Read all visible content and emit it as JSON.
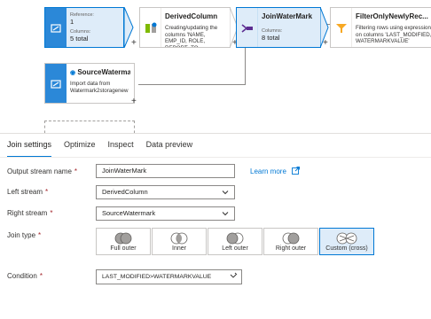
{
  "canvas": {
    "reference_node": {
      "label": "Reference:",
      "value": "1",
      "columns_label": "Columns:",
      "columns_value": "5 total"
    },
    "derived_column_node": {
      "title": "DerivedColumn",
      "description": "Creating/updating the columns 'NAME, EMP_ID, ROLE, REPORT_TO, LAST_MODIFIED'"
    },
    "join_watermark_node": {
      "title": "JoinWaterMark",
      "columns_label": "Columns:",
      "columns_value": "8 total"
    },
    "filter_node": {
      "title": "FilterOnlyNewlyRec...",
      "description": "Filtering rows using expressions on columns 'LAST_MODIFIED, WATERMARKVALUE'"
    },
    "source_watermark_node": {
      "title": "SourceWatermark",
      "description": "Import data from Watermark2storagenew"
    },
    "plus_symbol": "+"
  },
  "tabs": [
    {
      "label": "Join settings",
      "active": true
    },
    {
      "label": "Optimize",
      "active": false
    },
    {
      "label": "Inspect",
      "active": false
    },
    {
      "label": "Data preview",
      "active": false
    }
  ],
  "form": {
    "required_mark": "*",
    "output_stream": {
      "label": "Output stream name",
      "value": "JoinWaterMark"
    },
    "learn_more": "Learn more",
    "left_stream": {
      "label": "Left stream",
      "value": "DerivedColumn"
    },
    "right_stream": {
      "label": "Right stream",
      "value": "SourceWatermark"
    },
    "join_type": {
      "label": "Join type",
      "options": [
        {
          "label": "Full outer",
          "selected": false
        },
        {
          "label": "Inner",
          "selected": false
        },
        {
          "label": "Left outer",
          "selected": false
        },
        {
          "label": "Right outer",
          "selected": false
        },
        {
          "label": "Custom (cross)",
          "selected": true
        }
      ]
    },
    "condition": {
      "label": "Condition",
      "value": "LAST_MODIFIED>WATERMARKVALUE"
    }
  },
  "colors": {
    "accent": "#0078d4",
    "selected_bg": "#deecf9",
    "node_icon": "#2b88d8",
    "filter_icon": "#f7a823",
    "required": "#a4262c"
  }
}
